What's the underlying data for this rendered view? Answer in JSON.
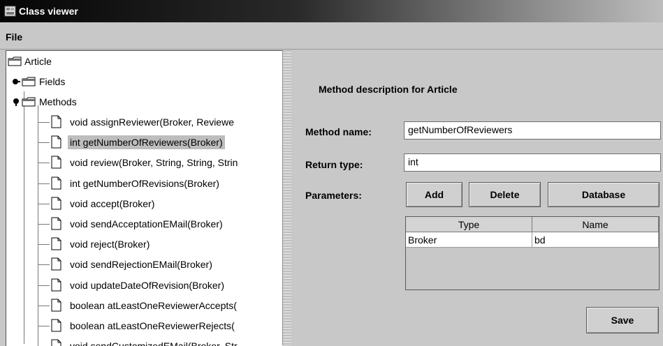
{
  "window": {
    "title": "Class viewer"
  },
  "menu": {
    "file_label": "File"
  },
  "tree": {
    "root": {
      "label": "Article",
      "icon": "folder-icon"
    },
    "fields": {
      "label": "Fields",
      "icon": "folder-icon",
      "expanded": false
    },
    "methods": {
      "label": "Methods",
      "icon": "folder-icon",
      "expanded": true,
      "items": [
        {
          "label": "void assignReviewer(Broker, Reviewe"
        },
        {
          "label": "int getNumberOfReviewers(Broker)",
          "selected": true
        },
        {
          "label": "void review(Broker, String, String, Strin"
        },
        {
          "label": "int getNumberOfRevisions(Broker)"
        },
        {
          "label": "void accept(Broker)"
        },
        {
          "label": "void sendAcceptationEMail(Broker)"
        },
        {
          "label": "void reject(Broker)"
        },
        {
          "label": "void sendRejectionEMail(Broker)"
        },
        {
          "label": "void updateDateOfRevision(Broker)"
        },
        {
          "label": "boolean atLeastOneReviewerAccepts("
        },
        {
          "label": "boolean atLeastOneReviewerRejects("
        },
        {
          "label": "void sendCustomizedEMail(Broker, Str"
        }
      ]
    }
  },
  "detail": {
    "heading": "Method description for Article",
    "method_name_label": "Method name:",
    "method_name_value": "getNumberOfReviewers",
    "return_type_label": "Return type:",
    "return_type_value": "int",
    "parameters_label": "Parameters:",
    "buttons": {
      "add": "Add",
      "delete": "Delete",
      "database": "Database"
    },
    "params_table": {
      "columns": [
        "Type",
        "Name"
      ],
      "rows": [
        {
          "type": "Broker",
          "name": "bd"
        }
      ]
    },
    "save_label": "Save"
  },
  "colors": {
    "selection": "#bdbdbd",
    "panel": "#c8c8c8",
    "titlebar": "#050505"
  }
}
